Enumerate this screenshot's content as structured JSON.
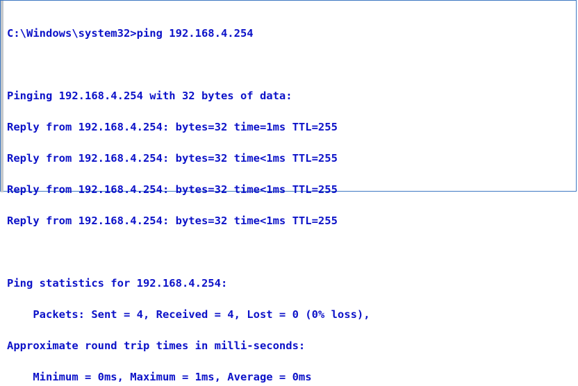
{
  "console": {
    "command_line": "C:\\Windows\\system32>ping 192.168.4.254",
    "pinging_line": "Pinging 192.168.4.254 with 32 bytes of data:",
    "replies": [
      "Reply from 192.168.4.254: bytes=32 time=1ms TTL=255",
      "Reply from 192.168.4.254: bytes=32 time<1ms TTL=255",
      "Reply from 192.168.4.254: bytes=32 time<1ms TTL=255",
      "Reply from 192.168.4.254: bytes=32 time<1ms TTL=255"
    ],
    "stats_header": "Ping statistics for 192.168.4.254:",
    "packets_line": "    Packets: Sent = 4, Received = 4, Lost = 0 (0% loss),",
    "rtt_header": "Approximate round trip times in milli-seconds:",
    "rtt_line": "    Minimum = 0ms, Maximum = 1ms, Average = 0ms"
  },
  "colors": {
    "text": "#0c12c8",
    "background": "#ffffff",
    "border": "#3d78c2"
  }
}
